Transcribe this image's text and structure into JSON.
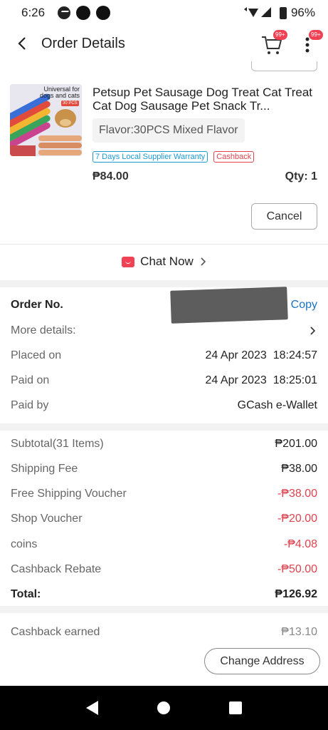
{
  "status_bar": {
    "time": "6:26",
    "battery": "96%"
  },
  "header": {
    "title": "Order Details",
    "cart_badge": "99+",
    "more_badge": "99+"
  },
  "product": {
    "image_caption_line1": "Universal for",
    "image_caption_line2": "dogs and cats",
    "image_badge": "30 PCS",
    "title": "Petsup Pet Sausage Dog Treat Cat Treat Cat Dog Sausage Pet Snack Tr...",
    "variant": "Flavor:30PCS Mixed Flavor",
    "tags": [
      "7 Days Local Supplier Warranty",
      "Cashback"
    ],
    "price": "₱84.00",
    "qty": "Qty: 1"
  },
  "actions": {
    "cancel_label": "Cancel",
    "chat_label": "Chat Now",
    "change_address_label": "Change Address"
  },
  "order_info": {
    "order_no_label": "Order No.",
    "copy_label": "Copy",
    "more_details_label": "More details:",
    "placed_on_label": "Placed on",
    "placed_on_value": "24 Apr 2023  18:24:57",
    "paid_on_label": "Paid on",
    "paid_on_value": "24 Apr 2023  18:25:01",
    "paid_by_label": "Paid by",
    "paid_by_value": "GCash e-Wallet"
  },
  "summary": {
    "rows": [
      {
        "label": "Subtotal(31 Items)",
        "value": "₱201.00"
      },
      {
        "label": "Shipping Fee",
        "value": "₱38.00"
      },
      {
        "label": "Free Shipping Voucher",
        "value": "-₱38.00"
      },
      {
        "label": "Shop Voucher",
        "value": "-₱20.00"
      },
      {
        "label": "coins",
        "value": "-₱4.08"
      },
      {
        "label": "Cashback Rebate",
        "value": "-₱50.00"
      }
    ],
    "total_label": "Total:",
    "total_value": "₱126.92",
    "cashback_earned_label": "Cashback earned",
    "cashback_earned_value": "₱13.10"
  },
  "colors": {
    "accent_red": "#e0434f",
    "link_blue": "#1a73c6",
    "badge_red": "#f04155"
  }
}
